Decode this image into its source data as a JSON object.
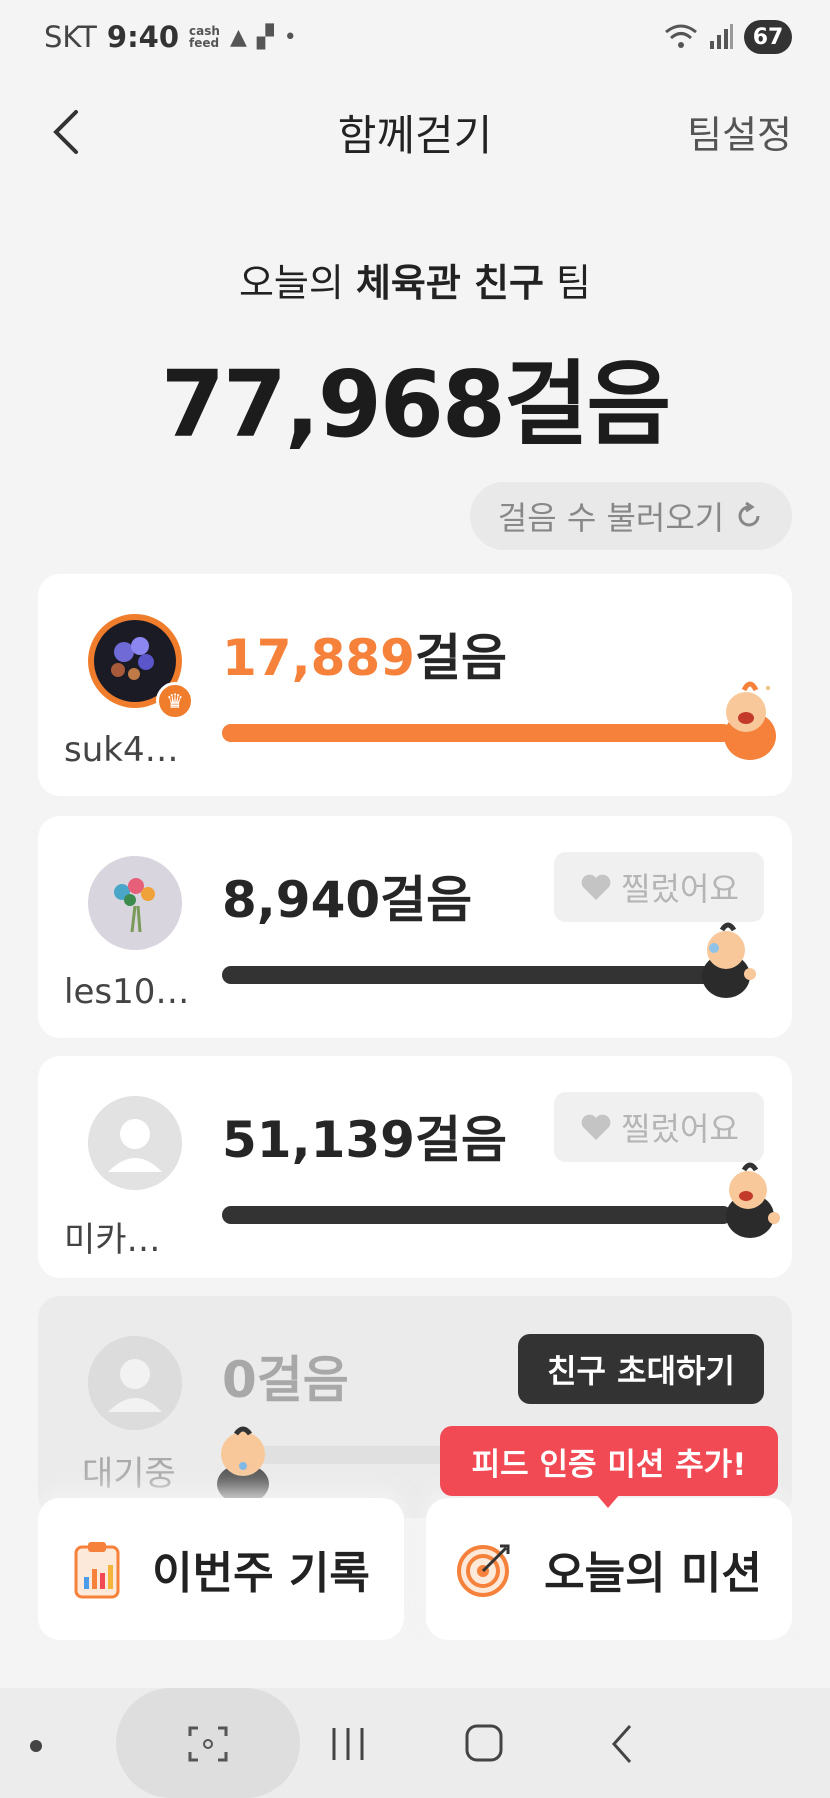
{
  "status_bar": {
    "carrier": "SKT",
    "time": "9:40",
    "cashfeed_top": "cash",
    "cashfeed_bottom": "feed",
    "battery": "67"
  },
  "header": {
    "title": "함께걷기",
    "team_settings": "팀설정"
  },
  "summary": {
    "prefix": "오늘의 ",
    "team_name": "체육관 친구",
    "suffix": " 팀",
    "total_steps": "77,968걸음"
  },
  "load_steps_label": "걸음 수 불러오기",
  "members": [
    {
      "name": "suk4…",
      "steps": "17,889",
      "progress": 1.0,
      "is_leader": true
    },
    {
      "name": "les10…",
      "steps": "8,940",
      "poke_label": "찔렀어요",
      "progress": 1.0
    },
    {
      "name": "미카…",
      "steps": "51,139",
      "poke_label": "찔렀어요",
      "progress": 1.0
    },
    {
      "name": "대기중",
      "steps": "0",
      "progress": 0.0
    }
  ],
  "step_unit": "걸음",
  "invite_button": "친구 초대하기",
  "tooltip": "피드 인증 미션 추가!",
  "bottom": {
    "weekly_label": "이번주 기록",
    "mission_label": "오늘의 미션"
  },
  "colors": {
    "accent": "#f5813a",
    "dark_bar": "#333333",
    "tooltip": "#f24a55"
  }
}
